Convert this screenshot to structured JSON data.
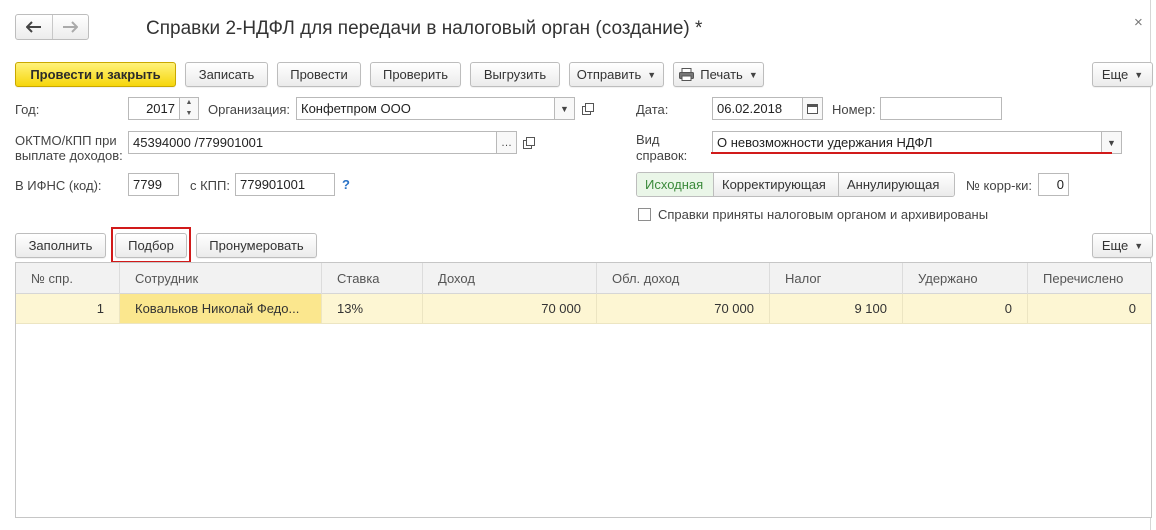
{
  "window": {
    "title": "Справки 2-НДФЛ для передачи в налоговый орган (создание) *",
    "close_glyph": "×",
    "back_glyph": "🡐",
    "forward_glyph": "🡒"
  },
  "toolbar": {
    "post_close": "Провести и закрыть",
    "save": "Записать",
    "post": "Провести",
    "check": "Проверить",
    "export": "Выгрузить",
    "send": "Отправить",
    "print": "Печать",
    "more": "Еще"
  },
  "form": {
    "year_label": "Год:",
    "year_value": "2017",
    "org_label": "Организация:",
    "org_value": "Конфетпром ООО",
    "oktmo_label_line1": "ОКТМО/КПП при",
    "oktmo_label_line2": "выплате доходов:",
    "oktmo_value": "45394000   /779901001",
    "ifns_label": "В ИФНС (код):",
    "ifns_value": "7799",
    "kpp_label": "с КПП:",
    "kpp_value": "779901001",
    "help": "?",
    "date_label": "Дата:",
    "date_value": "06.02.2018",
    "number_label": "Номер:",
    "number_value": "",
    "kind_label_line1": "Вид",
    "kind_label_line2": "справок:",
    "kind_value": "О невозможности удержания НДФЛ",
    "seg_initial": "Исходная",
    "seg_corrective": "Корректирующая",
    "seg_cancel": "Аннулирующая",
    "corr_label": "№ корр-ки:",
    "corr_value": "0",
    "archived_label": "Справки приняты налоговым органом и архивированы",
    "archived_checked": false
  },
  "table_toolbar": {
    "fill": "Заполнить",
    "select": "Подбор",
    "renumber": "Пронумеровать",
    "more": "Еще"
  },
  "table": {
    "columns": [
      "№ спр.",
      "Сотрудник",
      "Ставка",
      "Доход",
      "Обл. доход",
      "Налог",
      "Удержано",
      "Перечислено"
    ],
    "rows": [
      [
        "1",
        "Ковальков Николай Федо...",
        "13%",
        "70 000",
        "70 000",
        "9 100",
        "0",
        "0"
      ]
    ]
  },
  "colors": {
    "primary_button": "#f6d60c",
    "highlight_red": "#d11a1a",
    "active_segment_text": "#3a8a3a",
    "row_background": "#fdf6d3"
  }
}
